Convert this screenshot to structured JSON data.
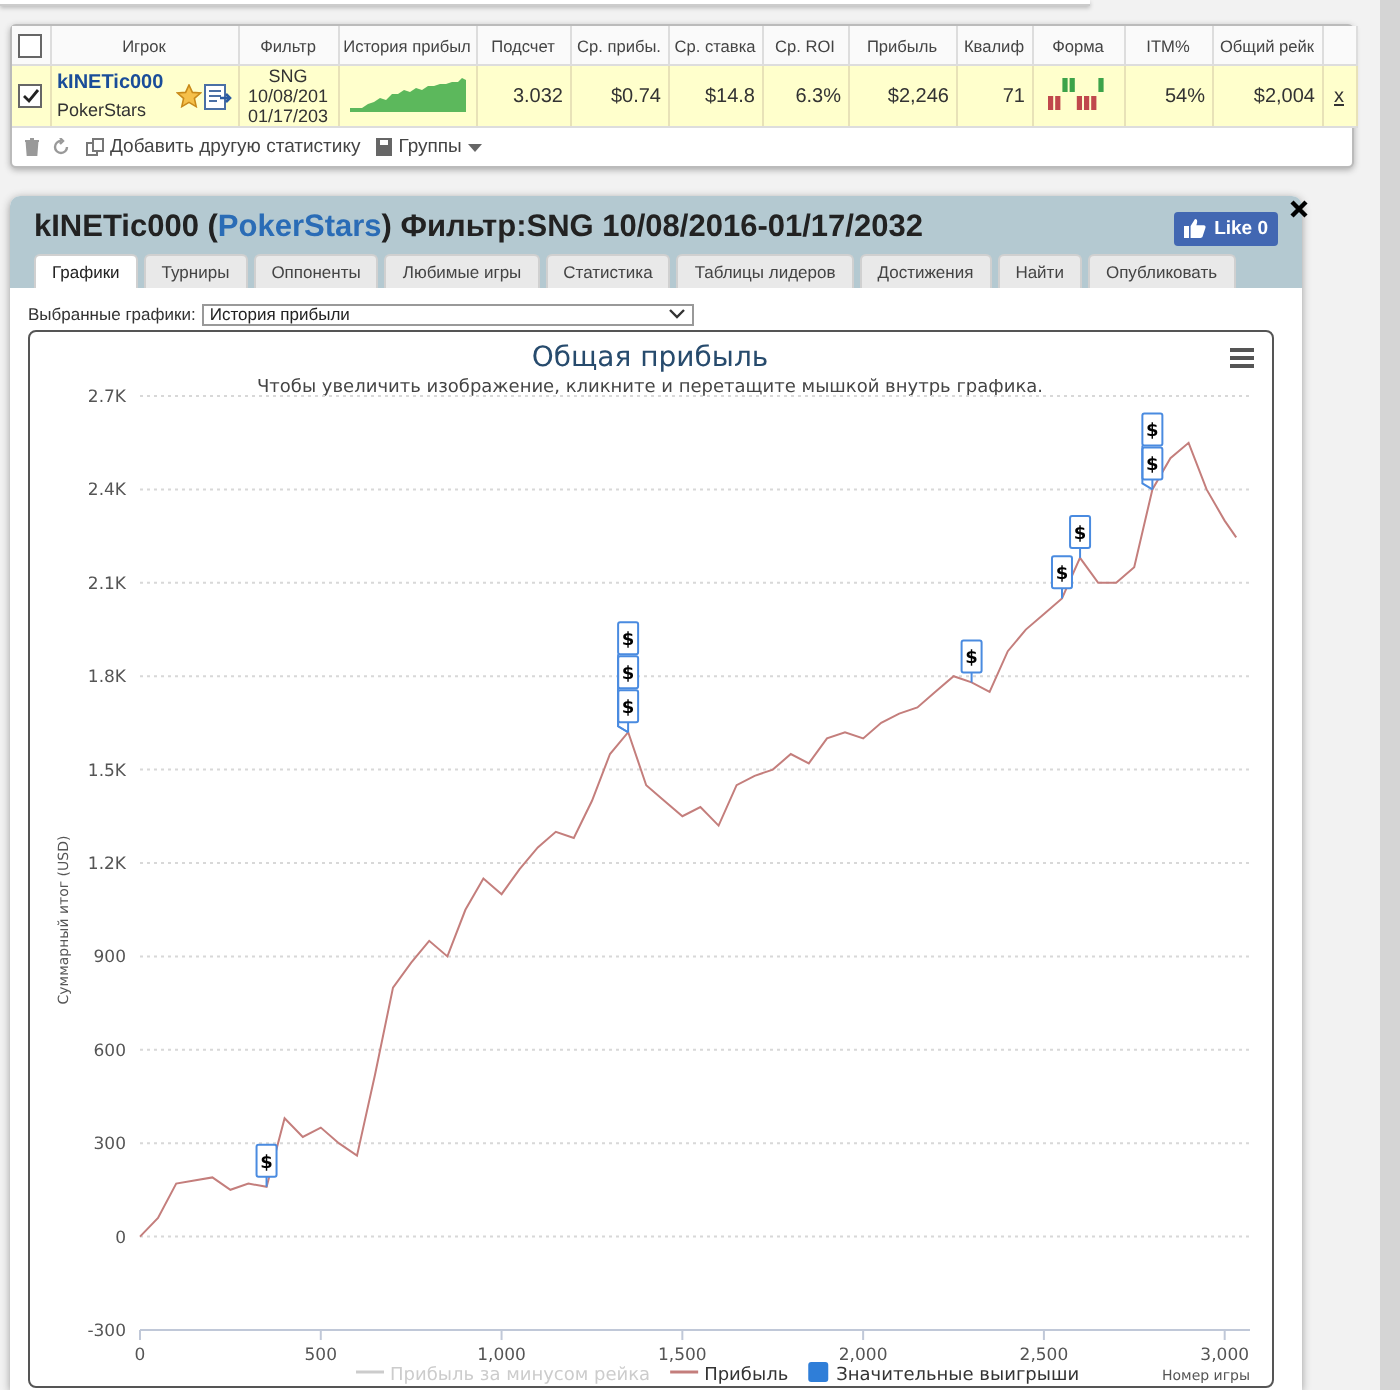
{
  "stats_table": {
    "select_all": {
      "checked": false
    },
    "columns": [
      "Игрок",
      "Фильтр",
      "История прибыл",
      "Подсчет",
      "Ср. прибы.",
      "Ср. ставка",
      "Ср. ROI",
      "Прибыль",
      "Квалиф",
      "Форма",
      "ITM%",
      "Общий рейк"
    ],
    "rows": [
      {
        "checked": true,
        "player": "kINETic000",
        "site": "PokerStars",
        "filter": [
          "SNG",
          "10/08/201",
          "01/17/203"
        ],
        "count": "3.032",
        "avg_profit": "$0.74",
        "avg_stake": "$14.8",
        "avg_roi": "6.3%",
        "profit": "$2,246",
        "qualif": "71",
        "form": [
          {
            "won": false
          },
          {
            "won": false
          },
          {
            "won": true
          },
          {
            "won": true
          },
          {
            "won": false
          },
          {
            "won": false
          },
          {
            "won": false
          },
          {
            "won": true
          }
        ],
        "itm": "54%",
        "total_rake": "$2,004",
        "remove": "x"
      }
    ],
    "footer": {
      "add_stat": "Добавить другую статистику",
      "groups": "Группы"
    }
  },
  "dialog": {
    "title": {
      "player": "kINETic000 (",
      "site": "PokerStars",
      "rest": ") Фильтр:SNG 10/08/2016-01/17/2032"
    },
    "like": {
      "label": "Like",
      "count": "0"
    },
    "tabs": [
      {
        "label": "Графики",
        "selected": true
      },
      {
        "label": "Турниры",
        "selected": false
      },
      {
        "label": "Оппоненты",
        "selected": false
      },
      {
        "label": "Любимые игры",
        "selected": false
      },
      {
        "label": "Статистика",
        "selected": false
      },
      {
        "label": "Таблицы лидеров",
        "selected": false
      },
      {
        "label": "Достижения",
        "selected": false
      },
      {
        "label": "Найти",
        "selected": false
      },
      {
        "label": "Опубликовать",
        "selected": false
      }
    ],
    "chart_select": {
      "label": "Выбранные графики:",
      "value": "История прибыли"
    },
    "chart": {
      "subtitle": "Чтобы увеличить изображение, кликните и перетащите мышкой внутрь графика.",
      "legend": [
        {
          "label": "Прибыль за минусом рейка",
          "kind": "line",
          "visible": false
        },
        {
          "kind": "series",
          "visible": true
        },
        {
          "label": "Значительные выигрыши",
          "kind": "flag",
          "visible": true
        }
      ],
      "chart_data": {
        "type": "line",
        "title": "Общая прибыль",
        "xlabel": "Номер игры",
        "ylabel": "Суммарный итог (USD)",
        "x": [
          0,
          50,
          100,
          150,
          200,
          250,
          300,
          350,
          400,
          450,
          500,
          550,
          600,
          650,
          700,
          750,
          800,
          850,
          900,
          950,
          1000,
          1050,
          1100,
          1150,
          1200,
          1250,
          1300,
          1350,
          1400,
          1450,
          1500,
          1550,
          1600,
          1650,
          1700,
          1750,
          1800,
          1850,
          1900,
          1950,
          2000,
          2050,
          2100,
          2150,
          2200,
          2250,
          2300,
          2350,
          2400,
          2450,
          2500,
          2550,
          2600,
          2650,
          2700,
          2750,
          2800,
          2850,
          2900,
          2950,
          3000,
          3032
        ],
        "series": [
          {
            "name": "Прибыль",
            "color": "#c47e7c",
            "values": [
              0,
              60,
              170,
              180,
              190,
              150,
              170,
              160,
              380,
              320,
              350,
              300,
              260,
              520,
              800,
              880,
              950,
              900,
              1050,
              1150,
              1100,
              1180,
              1250,
              1300,
              1280,
              1400,
              1550,
              1620,
              1450,
              1400,
              1350,
              1380,
              1320,
              1450,
              1480,
              1500,
              1550,
              1520,
              1600,
              1620,
              1600,
              1650,
              1680,
              1700,
              1750,
              1800,
              1780,
              1750,
              1880,
              1950,
              2000,
              2050,
              2180,
              2100,
              2100,
              2150,
              2400,
              2500,
              2550,
              2400,
              2300,
              2246
            ]
          }
        ],
        "xlim": [
          0,
          3070
        ],
        "ylim": [
          -300,
          2700
        ],
        "grid": true,
        "xticks": [
          0,
          500,
          {
            "value": 1000,
            "label": "1,000"
          },
          {
            "value": 1500,
            "label": "1,500"
          },
          {
            "value": 2000,
            "label": "2,000"
          },
          {
            "value": 2500,
            "label": "2,500"
          },
          {
            "value": 3000,
            "label": "3,000"
          }
        ],
        "yticks": [
          -300,
          0,
          300,
          600,
          900,
          {
            "value": 1200,
            "label": "1.2K"
          },
          {
            "value": 1500,
            "label": "1.5K"
          },
          {
            "value": 1800,
            "label": "1.8K"
          },
          {
            "value": 2100,
            "label": "2.1K"
          },
          {
            "value": 2400,
            "label": "2.4K"
          },
          {
            "value": 2700,
            "label": "2.7K"
          }
        ],
        "annotations": [
          {
            "x": 350,
            "y": 160,
            "text": "$"
          },
          {
            "x": 1350,
            "y": 1620,
            "text": "$"
          },
          {
            "x": 1350,
            "y": 1620,
            "text": "$"
          },
          {
            "x": 1350,
            "y": 1620,
            "text": "$"
          },
          {
            "x": 2300,
            "y": 1780,
            "text": "$"
          },
          {
            "x": 2550,
            "y": 2050,
            "text": "$"
          },
          {
            "x": 2600,
            "y": 2180,
            "text": "$"
          },
          {
            "x": 2800,
            "y": 2400,
            "text": "$"
          },
          {
            "x": 2800,
            "y": 2400,
            "text": "$"
          }
        ]
      }
    }
  }
}
